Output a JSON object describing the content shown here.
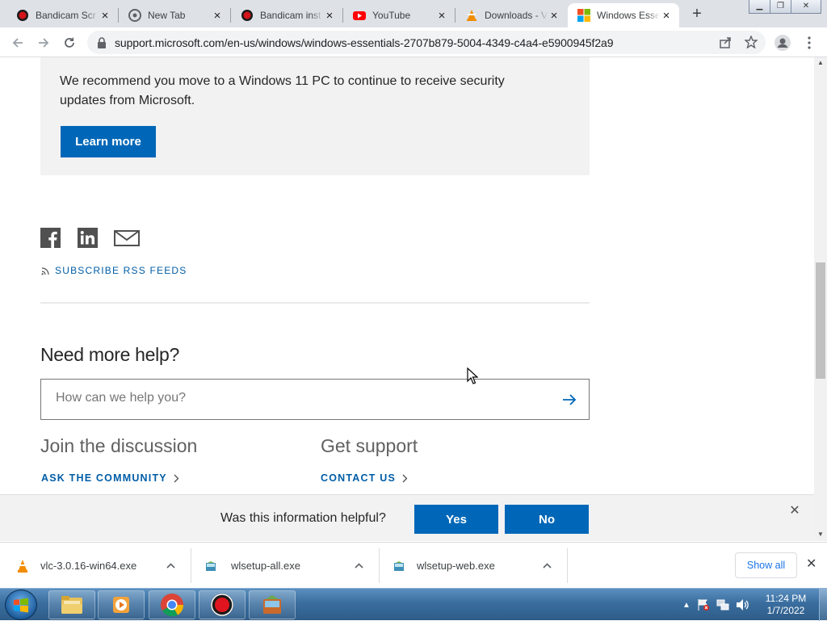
{
  "browser": {
    "tabs": [
      {
        "title": "Bandicam Scr",
        "icon": "bandicam-icon",
        "active": false
      },
      {
        "title": "New Tab",
        "icon": "chrome-icon",
        "active": false
      },
      {
        "title": "Bandicam inst",
        "icon": "bandicam-icon",
        "active": false
      },
      {
        "title": "YouTube",
        "icon": "youtube-icon",
        "active": false
      },
      {
        "title": "Downloads - V",
        "icon": "vlc-icon",
        "active": false
      },
      {
        "title": "Windows Esse",
        "icon": "microsoft-icon",
        "active": true
      }
    ],
    "url": "support.microsoft.com/en-us/windows/windows-essentials-2707b879-5004-4349-c4a4-e5900945f2a9"
  },
  "page": {
    "recommend_text": "We recommend you move to a Windows 11 PC to continue to receive security updates from Microsoft.",
    "learn_more": "Learn more",
    "share_icons": [
      "facebook-icon",
      "linkedin-icon",
      "email-icon"
    ],
    "rss_label": "SUBSCRIBE RSS FEEDS",
    "need_help": "Need more help?",
    "search_placeholder": "How can we help you?",
    "search_value": "",
    "discussion_heading": "Join the discussion",
    "ask_community": "ASK THE COMMUNITY",
    "support_heading": "Get support",
    "contact_us": "CONTACT US"
  },
  "feedback": {
    "question": "Was this information helpful?",
    "yes": "Yes",
    "no": "No"
  },
  "downloads": {
    "items": [
      {
        "name": "vlc-3.0.16-win64.exe",
        "icon": "vlc-file-icon"
      },
      {
        "name": "wlsetup-all.exe",
        "icon": "installer-file-icon"
      },
      {
        "name": "wlsetup-web.exe",
        "icon": "installer-file-icon"
      }
    ],
    "show_all": "Show all"
  },
  "taskbar": {
    "time": "11:24 PM",
    "date": "1/7/2022"
  },
  "colors": {
    "accent": "#0067b8",
    "link": "#005da6",
    "banner_bg": "#f2f2f2"
  }
}
